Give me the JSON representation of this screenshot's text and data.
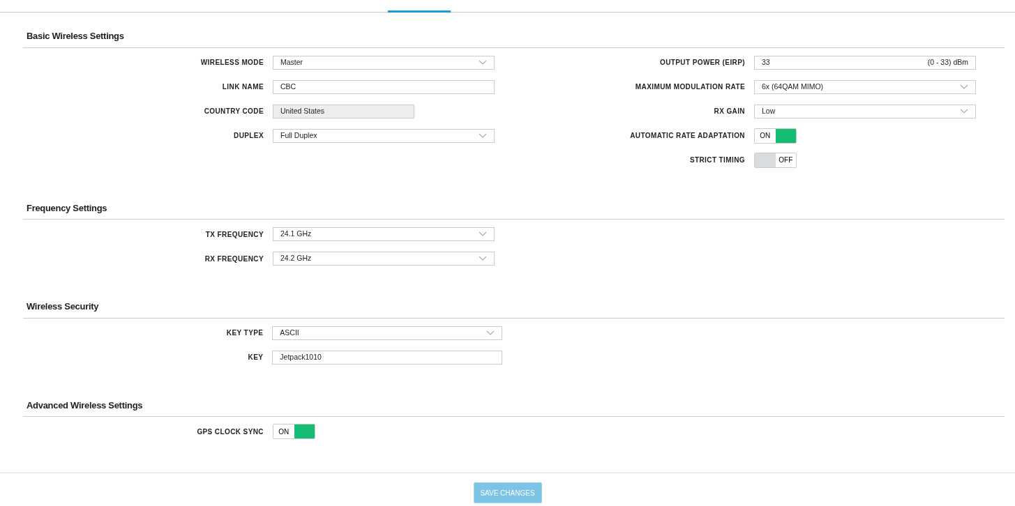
{
  "sections": [
    {
      "title": "Basic Wireless Settings",
      "kind": "standard",
      "columns": [
        [
          {
            "label": "WIRELESS MODE",
            "kind": "select",
            "value": "Master"
          },
          {
            "label": "LINK NAME",
            "kind": "text",
            "value": "CBC"
          },
          {
            "label": "COUNTRY CODE",
            "kind": "readonly",
            "value": "United States"
          },
          {
            "label": "DUPLEX",
            "kind": "select",
            "value": "Full Duplex"
          }
        ],
        [
          {
            "label": "OUTPUT POWER (EIRP)",
            "kind": "range",
            "value": "33",
            "hint": "(0 - 33) dBm"
          },
          {
            "label": "MAXIMUM MODULATION RATE",
            "kind": "select",
            "value": "6x (64QAM MIMO)"
          },
          {
            "label": "RX GAIN",
            "kind": "select",
            "value": "Low"
          },
          {
            "label": "AUTOMATIC RATE ADAPTATION",
            "kind": "toggle",
            "on": true,
            "text": "ON"
          },
          {
            "label": "STRICT TIMING",
            "kind": "toggle",
            "on": false,
            "text": "OFF"
          }
        ]
      ]
    },
    {
      "title": "Frequency Settings",
      "kind": "standard",
      "columns": [
        [
          {
            "label": "TX FREQUENCY",
            "kind": "select",
            "value": "24.1 GHz"
          },
          {
            "label": "RX FREQUENCY",
            "kind": "select",
            "value": "24.2 GHz"
          }
        ]
      ]
    },
    {
      "title": "Wireless Security",
      "kind": "wide",
      "columns": [
        [
          {
            "label": "KEY TYPE",
            "kind": "select",
            "value": "ASCII"
          },
          {
            "label": "KEY",
            "kind": "text",
            "value": "Jetpack1010"
          }
        ]
      ]
    },
    {
      "title": "Advanced Wireless Settings",
      "kind": "standard",
      "columns": [
        [
          {
            "label": "GPS CLOCK SYNC",
            "kind": "toggle",
            "on": true,
            "text": "ON"
          }
        ]
      ]
    }
  ],
  "save_button": {
    "label": "SAVE CHANGES",
    "disabled": true
  }
}
